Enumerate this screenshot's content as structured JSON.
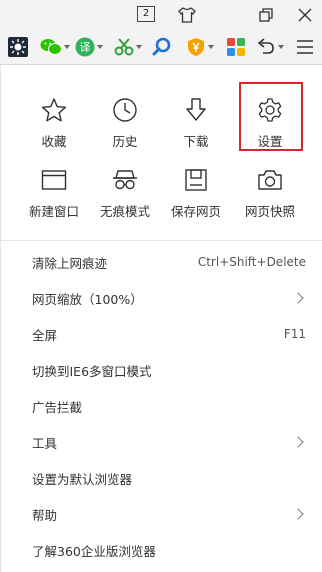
{
  "titlebar": {
    "tab_count": "2",
    "icons": [
      "shirt-icon",
      "restore-icon",
      "close-icon"
    ]
  },
  "toolbar": {
    "icons": [
      "sun-icon",
      "wechat-icon",
      "translate-icon",
      "scissors-icon",
      "search-icon",
      "shield-yen-icon",
      "apps-grid-icon",
      "undo-icon",
      "menu-icon"
    ],
    "translate_glyph": "译",
    "colors": {
      "wechat": "#2dc100",
      "translate": "#2fb15a",
      "scissors": "#31a13a",
      "search": "#1f6fd6",
      "shield": "#f5a300",
      "accent_red": "#d7262d"
    }
  },
  "grid": {
    "row1": [
      {
        "label": "收藏",
        "icon": "star-icon"
      },
      {
        "label": "历史",
        "icon": "clock-icon"
      },
      {
        "label": "下载",
        "icon": "download-arrow-icon"
      },
      {
        "label": "设置",
        "icon": "gear-icon"
      }
    ],
    "row2": [
      {
        "label": "新建窗口",
        "icon": "window-icon"
      },
      {
        "label": "无痕模式",
        "icon": "incognito-glasses-icon"
      },
      {
        "label": "保存网页",
        "icon": "save-floppy-icon"
      },
      {
        "label": "网页快照",
        "icon": "camera-icon"
      }
    ]
  },
  "menu_items": [
    {
      "label": "清除上网痕迹",
      "right": "Ctrl+Shift+Delete"
    },
    {
      "label": "网页缩放（100%）",
      "right": ">"
    },
    {
      "label": "全屏",
      "right": "F11"
    },
    {
      "label": "切换到IE6多窗口模式",
      "right": ""
    },
    {
      "label": "广告拦截",
      "right": ""
    },
    {
      "label": "工具",
      "right": ">"
    },
    {
      "label": "设置为默认浏览器",
      "right": ""
    },
    {
      "label": "帮助",
      "right": ">"
    },
    {
      "label": "了解360企业版浏览器",
      "right": ""
    }
  ]
}
